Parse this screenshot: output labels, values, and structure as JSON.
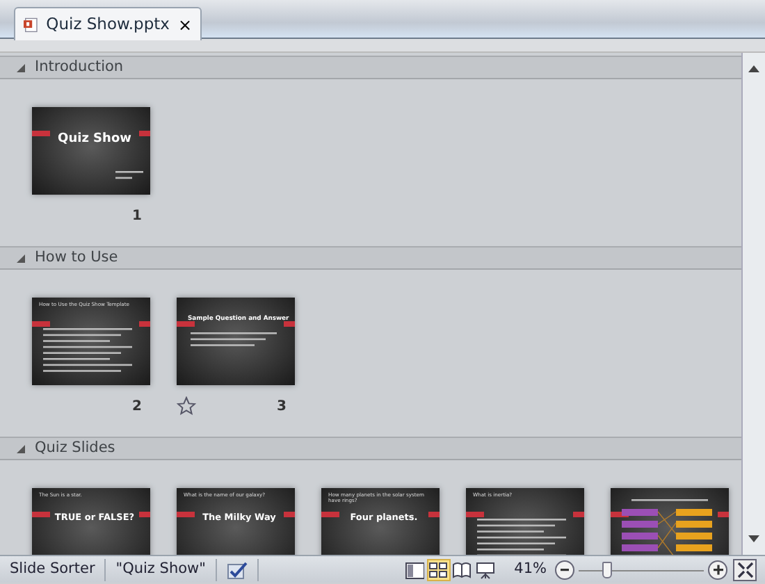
{
  "tab": {
    "title": "Quiz Show.pptx",
    "close": "×"
  },
  "sections": [
    {
      "name": "Introduction",
      "expanded": true,
      "slides": [
        {
          "number": "1",
          "kind": "title",
          "title": "Quiz Show",
          "animated": false
        }
      ]
    },
    {
      "name": "How to Use",
      "expanded": true,
      "slides": [
        {
          "number": "2",
          "kind": "bullets",
          "heading": "How to Use the Quiz Show Template",
          "animated": false
        },
        {
          "number": "3",
          "kind": "banner",
          "heading": "Sample Question and Answer",
          "animated": true
        }
      ]
    },
    {
      "name": "Quiz Slides",
      "expanded": true,
      "slides": [
        {
          "kind": "question",
          "heading": "The Sun is a star.",
          "title": "**TRUE** or FALSE?",
          "animated": false
        },
        {
          "kind": "question",
          "heading": "What is the name of our galaxy?",
          "title": "The Milky Way",
          "animated": false
        },
        {
          "kind": "question",
          "heading": "How many planets in the solar system have rings?",
          "title": "Four planets.",
          "animated": false
        },
        {
          "kind": "bullets",
          "heading": "What is inertia?",
          "animated": false
        },
        {
          "kind": "match",
          "animated": false
        }
      ]
    }
  ],
  "status_bar": {
    "items": [
      "Slide Sorter",
      "\"Quiz Show\""
    ],
    "views": [
      {
        "kind": "normal",
        "selected": false
      },
      {
        "kind": "sorter",
        "selected": true
      },
      {
        "kind": "reading",
        "selected": false
      },
      {
        "kind": "slideshow",
        "selected": false
      }
    ],
    "zoom": "41%",
    "zoom_slider": {
      "level": 0.2
    }
  }
}
